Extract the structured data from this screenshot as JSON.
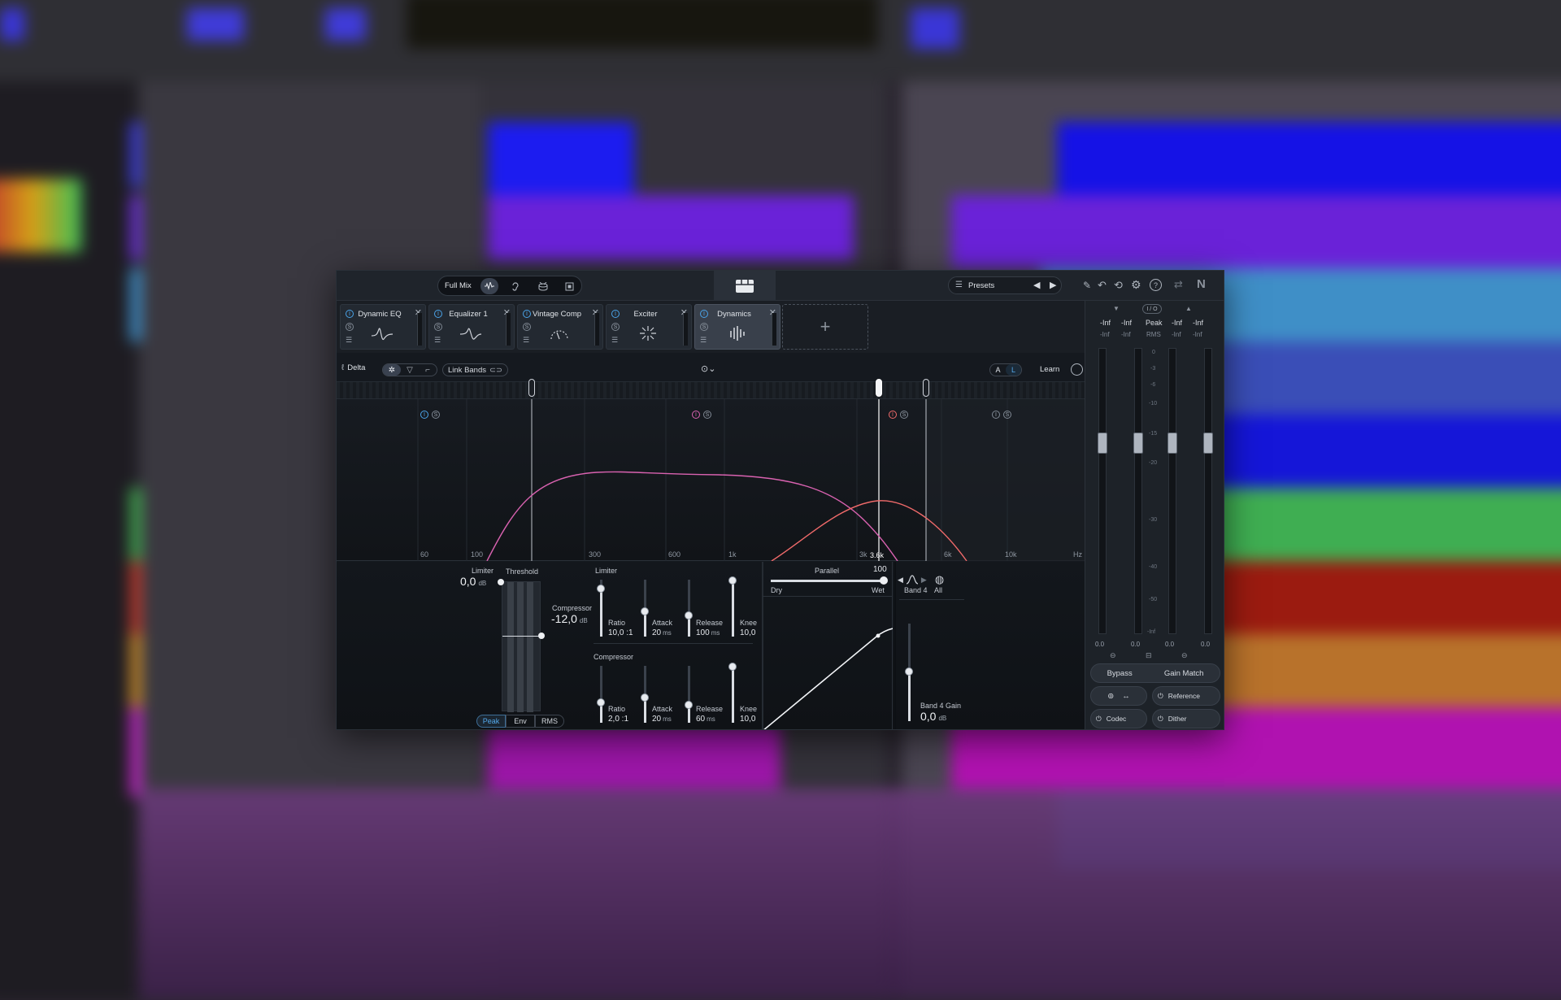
{
  "colors": {
    "accent": "#4aa3e8",
    "pink_curve": "#d962b0",
    "orange_curve": "#f06a6a",
    "panel": "#15191f"
  },
  "topbar": {
    "full_mix": "Full Mix",
    "presets": "Presets",
    "icons": [
      "spectrum-icon",
      "ear-icon",
      "drum-icon",
      "box-icon",
      "grid-icon",
      "pencil-icon",
      "undo-icon",
      "history-icon",
      "gear-icon",
      "help-icon",
      "link-icon",
      "ni-logo-icon"
    ],
    "logo": "N"
  },
  "modules": [
    {
      "title": "Dynamic EQ",
      "glyph": "eq"
    },
    {
      "title": "Equalizer 1",
      "glyph": "eq"
    },
    {
      "title": "Vintage Comp",
      "glyph": "gauge"
    },
    {
      "title": "Exciter",
      "glyph": "spark"
    },
    {
      "title": "Dynamics",
      "glyph": "bars"
    }
  ],
  "toolbar": {
    "delta": "Delta",
    "link_bands": "Link Bands",
    "ab_a": "A",
    "ab_b": "L",
    "learn": "Learn"
  },
  "spectrum": {
    "freq_labels": [
      "60",
      "100",
      "300",
      "600",
      "1k",
      "3k",
      "3.6k",
      "6k",
      "10k",
      "Hz"
    ],
    "band_markers": [
      "I",
      "S",
      "I",
      "S",
      "I",
      "S",
      "I",
      "S"
    ]
  },
  "limiter": {
    "title": "Limiter",
    "threshold_label": "Threshold",
    "value": "0,0",
    "unit": "dB",
    "ratio_label": "Ratio",
    "ratio_value": "10,0 :1",
    "attack_label": "Attack",
    "attack_value": "20",
    "attack_unit": "ms",
    "release_label": "Release",
    "release_value": "100",
    "release_unit": "ms",
    "knee_label": "Knee",
    "knee_value": "10,0"
  },
  "compressor": {
    "title": "Compressor",
    "value": "-12,0",
    "unit": "dB",
    "ratio_label": "Ratio",
    "ratio_value": "2,0 :1",
    "attack_label": "Attack",
    "attack_value": "20",
    "attack_unit": "ms",
    "release_label": "Release",
    "release_value": "60",
    "release_unit": "ms",
    "knee_label": "Knee",
    "knee_value": "10,0"
  },
  "detection": [
    "Peak",
    "Env",
    "RMS"
  ],
  "parallel": {
    "title": "Parallel",
    "value": "100",
    "dry": "Dry",
    "wet": "Wet"
  },
  "band": {
    "name": "Band 4",
    "all": "All",
    "gain_label": "Band 4 Gain",
    "gain_value": "0,0",
    "gain_unit": "dB"
  },
  "meters": {
    "peak_label": "Peak",
    "rms_label": "RMS",
    "io_label": "I / O",
    "peak_values": [
      "-Inf",
      "-Inf",
      "-Inf",
      "-Inf"
    ],
    "rms_values": [
      "-Inf",
      "-Inf",
      "-Inf",
      "-Inf"
    ],
    "scale": [
      "0",
      "-3",
      "-6",
      "-10",
      "-15",
      "-20",
      "-30",
      "-40",
      "-50",
      "-Inf"
    ],
    "fader_values": [
      "0.0",
      "0.0",
      "0.0",
      "0.0"
    ],
    "bypass": "Bypass",
    "gain_match": "Gain Match",
    "reference": "Reference",
    "codec": "Codec",
    "dither": "Dither"
  }
}
